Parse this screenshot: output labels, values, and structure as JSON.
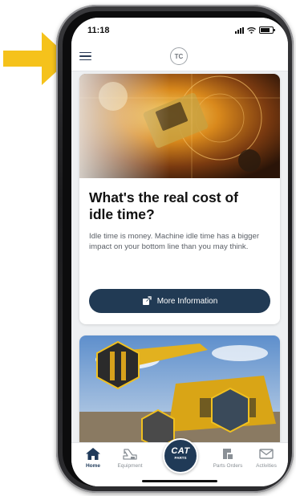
{
  "status_bar": {
    "time": "11:18"
  },
  "header": {
    "logo_text": "TC",
    "menu_icon": "hamburger-menu-icon"
  },
  "feed": [
    {
      "title": "What's the real cost of idle time?",
      "description": "Idle time is money. Machine idle time has a bigger impact on your bottom line than you may think.",
      "button_label": "More Information",
      "button_icon": "external-link-icon"
    }
  ],
  "bottom_nav": {
    "items": [
      {
        "label": "Home",
        "icon": "home-icon",
        "active": true
      },
      {
        "label": "Equipment",
        "icon": "excavator-icon",
        "active": false
      },
      {
        "label": "Parts Orders",
        "icon": "parts-orders-icon",
        "active": false
      },
      {
        "label": "Activities",
        "icon": "mail-icon",
        "active": false
      }
    ],
    "center_button": {
      "word": "CAT",
      "sub": "PARTS"
    }
  },
  "colors": {
    "annotation_arrow": "#f5c21b",
    "primary_navy": "#213a54",
    "background": "#eef0f2",
    "text_dark": "#111111",
    "text_muted": "#5a5f66"
  }
}
